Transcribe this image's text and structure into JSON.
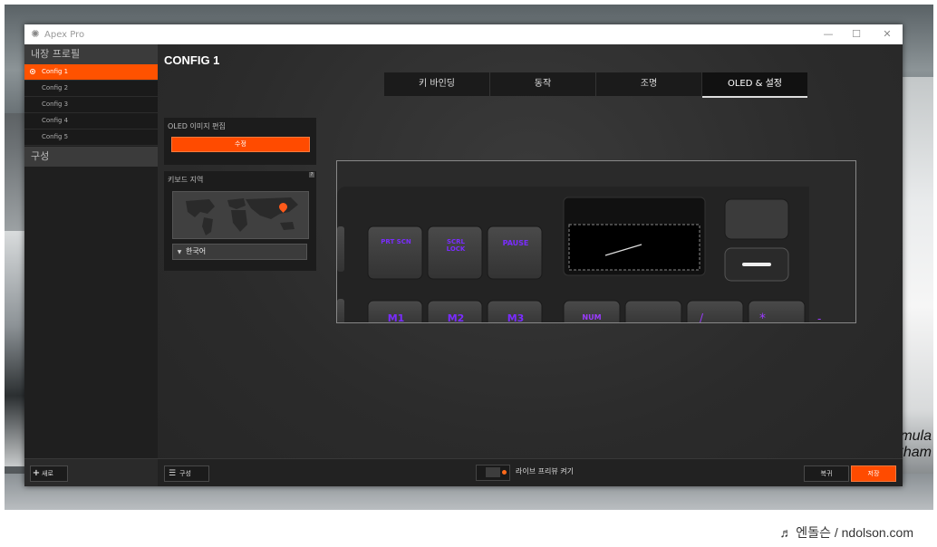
{
  "window": {
    "title": "Apex Pro",
    "minimize": "—",
    "maximize": "☐",
    "close": "✕"
  },
  "sidebar": {
    "header": "내장 프로필",
    "items": [
      {
        "label": "Config 1",
        "active": true
      },
      {
        "label": "Config 2",
        "active": false
      },
      {
        "label": "Config 3",
        "active": false
      },
      {
        "label": "Config 4",
        "active": false
      },
      {
        "label": "Config 5",
        "active": false
      }
    ],
    "section": "구성",
    "new_button": "새로"
  },
  "main": {
    "config_title": "CONFIG 1",
    "tabs": [
      {
        "label": "키 바인딩",
        "active": false
      },
      {
        "label": "동작",
        "active": false
      },
      {
        "label": "조명",
        "active": false
      },
      {
        "label": "OLED & 설정",
        "active": true
      }
    ],
    "oled_panel": {
      "label": "OLED 이미지 편집",
      "edit_button": "수정"
    },
    "region_panel": {
      "label": "키보드 지역",
      "help": "?",
      "selected_region": "한국어"
    },
    "keyboard_preview": {
      "keys_row1": [
        "PRT SCN",
        "SCRL LOCK",
        "PAUSE"
      ],
      "keys_row2": [
        "M1",
        "M2",
        "M3",
        "NUM"
      ]
    }
  },
  "bottombar": {
    "config_button": "구성",
    "live_preview_label": "라이브 프리뷰 켜기",
    "revert_button": "복귀",
    "save_button": "저장"
  },
  "desktop": {
    "car_text_line1": "Formula",
    "car_text_line2": "Cham"
  },
  "credit": "♬ 엔돌슨 / ndolson.com",
  "colors": {
    "accent": "#ff5200",
    "background": "#262626",
    "key_legend": "#7a2cff"
  }
}
